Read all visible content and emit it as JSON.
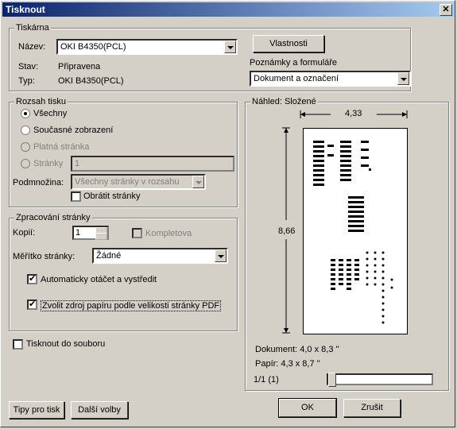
{
  "window": {
    "title": "Tisknout",
    "close": "✕"
  },
  "printer": {
    "group_label": "Tiskárna",
    "name_label": "Název:",
    "name_value": "OKI B4350(PCL)",
    "status_label": "Stav:",
    "status_value": "Připravena",
    "type_label": "Typ:",
    "type_value": "OKI B4350(PCL)",
    "properties_button": "Vlastnosti",
    "notes_label": "Poznámky a formuláře",
    "notes_value": "Dokument a označení"
  },
  "range": {
    "group_label": "Rozsah tisku",
    "all": "Všechny",
    "current_view": "Současné zobrazení",
    "current_page": "Platná stránka",
    "pages": "Stránky",
    "pages_value": "1",
    "subset_label": "Podmnožina:",
    "subset_value": "Všechny stránky v rozsahu",
    "reverse": "Obrátit stránky"
  },
  "handling": {
    "group_label": "Zpracování stránky",
    "copies_label": "Kopií:",
    "copies_value": "1",
    "collate": "Kompletova",
    "scale_label": "Měřítko stránky:",
    "scale_value": "Žádné",
    "auto_rotate": "Automaticky otáčet a vystředit",
    "paper_source": "Zvolit zdroj papíru podle velikosti stránky PDF"
  },
  "print_to_file": "Tisknout do souboru",
  "preview": {
    "group_label": "Náhled: Složené",
    "width_dim": "4,33",
    "height_dim": "8,66",
    "document": "Dokument: 4,0 x 8,3 ''",
    "paper": "Papír: 4,3 x 8,7 ''",
    "page_counter": "1/1 (1)"
  },
  "buttons": {
    "tips": "Tipy pro tisk",
    "more": "Další volby",
    "ok": "OK",
    "cancel": "Zrušit"
  }
}
